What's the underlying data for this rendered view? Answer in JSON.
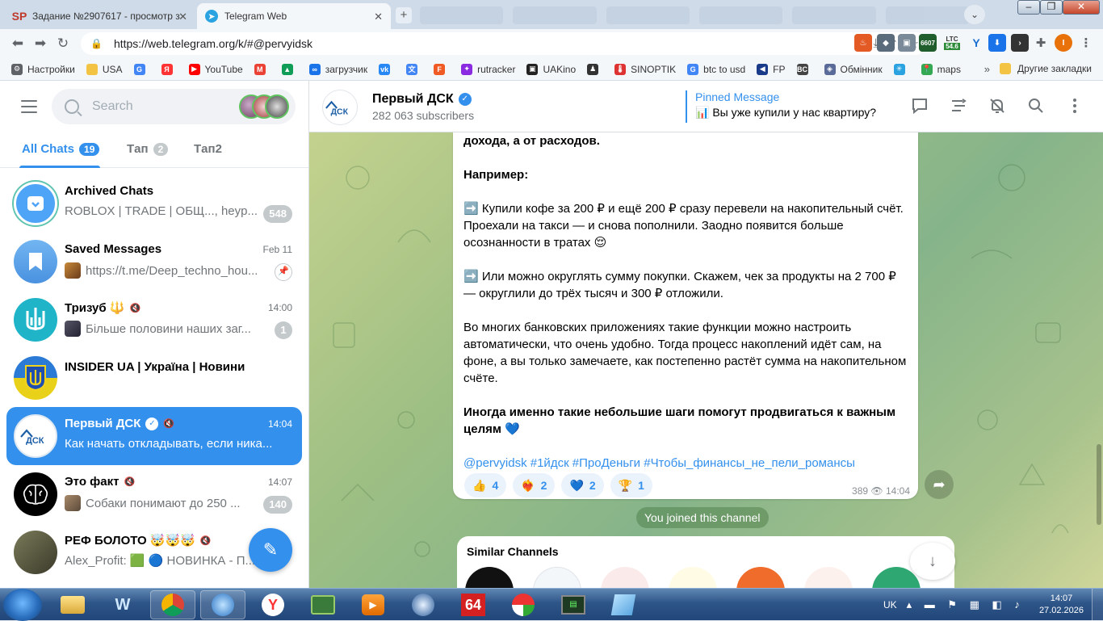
{
  "browser": {
    "tabs": [
      {
        "title": "Задание №2907617 - просмотр з",
        "favicon": "SP",
        "active": false
      },
      {
        "title": "Telegram Web",
        "favicon": "telegram-icon",
        "active": true
      }
    ],
    "url": "https://web.telegram.org/k/#@pervyidsk",
    "bookmarks": [
      {
        "label": "Настройки",
        "icon": "gear-icon"
      },
      {
        "label": "USA",
        "icon": "folder-icon"
      },
      {
        "label": "",
        "icon": "google-icon"
      },
      {
        "label": "",
        "icon": "yandex-icon"
      },
      {
        "label": "YouTube",
        "icon": "youtube-icon"
      },
      {
        "label": "",
        "icon": "gmail-icon"
      },
      {
        "label": "",
        "icon": "drive-icon"
      },
      {
        "label": "загрузчик",
        "icon": "link-icon"
      },
      {
        "label": "",
        "icon": "vk-icon"
      },
      {
        "label": "",
        "icon": "translate-icon"
      },
      {
        "label": "",
        "icon": "f-icon"
      },
      {
        "label": "rutracker",
        "icon": "rutracker-icon"
      },
      {
        "label": "UAKino",
        "icon": "uakino-icon"
      },
      {
        "label": "",
        "icon": "figure-icon"
      },
      {
        "label": "SINOPTIK",
        "icon": "thermometer-icon"
      },
      {
        "label": "btc to usd",
        "icon": "google-icon"
      },
      {
        "label": "FP",
        "icon": "fp-icon"
      },
      {
        "label": "",
        "icon": "bc-icon"
      },
      {
        "label": "Обмінник",
        "icon": "exchange-icon"
      },
      {
        "label": "",
        "icon": "snowflake-icon"
      },
      {
        "label": "maps",
        "icon": "maps-icon"
      }
    ],
    "bookmarks_more": "»",
    "other_bookmarks": "Другие закладки",
    "extensions": {
      "ext_6607": "6607",
      "ltc_label": "LTC",
      "ltc_value": "54.6"
    },
    "profile_letter": "I"
  },
  "telegram": {
    "search_placeholder": "Search",
    "folders": [
      {
        "label": "All Chats",
        "count": "19",
        "active": true
      },
      {
        "label": "Tап",
        "count": "2",
        "active": false
      },
      {
        "label": "Tап2",
        "count": "",
        "active": false
      }
    ],
    "chats": [
      {
        "title": "Archived Chats",
        "preview": "ROBLOX | TRADE | ОБЩ..., heyp...",
        "time": "",
        "badge": "548",
        "avatar": "archive-icon"
      },
      {
        "title": "Saved Messages",
        "preview": "https://t.me/Deep_techno_hou...",
        "time": "Feb 11",
        "badge": "",
        "avatar": "bookmark-icon"
      },
      {
        "title": "Тризуб 🔱",
        "preview": "Більше половини наших заг...",
        "time": "14:00",
        "badge": "1",
        "avatar": "trident-icon"
      },
      {
        "title": "INSIDER UA | Україна | Новини",
        "preview": "",
        "time": "",
        "badge": "",
        "avatar": "coat-of-arms-icon"
      },
      {
        "title": "Первый ДСК",
        "preview": "Как начать откладывать, если ника...",
        "time": "14:04",
        "badge": "",
        "avatar": "dsk-logo"
      },
      {
        "title": "Это факт",
        "preview": "Собаки понимают до 250 ...",
        "time": "14:07",
        "badge": "140",
        "avatar": "brain-icon"
      },
      {
        "title": "РЕФ БОЛОТО 🤯🤯🤯",
        "preview": "Alex_Profit: 🟩 🔵 НОВИНКА - П...",
        "time": "",
        "badge": "",
        "avatar": "group-photo"
      }
    ],
    "channel": {
      "title": "Первый ДСК",
      "subscribers": "282 063 subscribers",
      "pinned_label": "Pinned Message",
      "pinned_text": "📊 Вы уже купили у нас квартиру?"
    },
    "message": {
      "p1": "дохода, а от расходов.",
      "p2": "Например:",
      "p3": "➡️ Купили кофе за 200 ₽ и ещё 200 ₽ сразу перевели на накопительный счёт. Проехали на такси — и снова пополнили. Заодно появится больше осознанности в тратах 😌",
      "p4": "➡️ Или можно округлять сумму покупки. Скажем, чек за продукты на 2 700 ₽ — округлили до трёх тысяч и 300 ₽ отложили.",
      "p5": "Во многих банковских приложениях такие функции можно настроить автоматически, что очень удобно. Тогда процесс накоплений идёт сам, на фоне, а вы только замечаете, как постепенно растёт сумма на накопительном счёте.",
      "p6": "Иногда именно такие небольшие шаги помогут продвигаться к важным целям 💙",
      "hashtags": "@pervyidsk #1йдск #ПроДеньги #Чтобы_финансы_не_пели_романсы",
      "reactions": [
        {
          "emoji": "👍",
          "count": "4"
        },
        {
          "emoji": "❤️‍🔥",
          "count": "2"
        },
        {
          "emoji": "💙",
          "count": "2"
        },
        {
          "emoji": "🏆",
          "count": "1"
        }
      ],
      "views": "389",
      "time": "14:04"
    },
    "joined_notice": "You joined this channel",
    "similar_title": "Similar Channels"
  },
  "taskbar": {
    "lang": "UK",
    "time": "14:07",
    "date": "27.02.2026",
    "app_64": "64"
  },
  "colors": {
    "accent": "#3390ec",
    "taskbar": "#2e5588"
  }
}
